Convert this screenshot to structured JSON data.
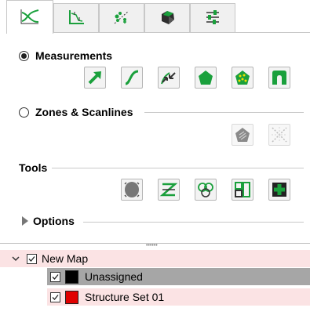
{
  "tabs": [
    {
      "icon": "curves-icon"
    },
    {
      "icon": "plot-axes-icon"
    },
    {
      "icon": "scatter-points-icon"
    },
    {
      "icon": "polyhedron-icon"
    },
    {
      "icon": "sliders-icon"
    }
  ],
  "measurements": {
    "label": "Measurements",
    "selected": true,
    "tools": [
      "arrow-measure-icon",
      "curve-measure-icon",
      "convergence-measure-icon",
      "polygon-measure-icon",
      "region-measure-icon",
      "tunnel-measure-icon"
    ]
  },
  "zones": {
    "label": "Zones & Scanlines",
    "selected": false,
    "tools": [
      "zone-polygon-icon",
      "scanline-icon"
    ]
  },
  "tools": {
    "label": "Tools",
    "tools": [
      "blob-tool-icon",
      "section-tool-icon",
      "cluster-tool-icon",
      "layout-tool-icon",
      "add-tool-icon"
    ]
  },
  "options": {
    "label": "Options"
  },
  "tree": {
    "root": {
      "label": "New Map",
      "checked": true
    },
    "items": [
      {
        "label": "Unassigned",
        "checked": true,
        "color": "#000000"
      },
      {
        "label": "Structure Set 01",
        "checked": true,
        "color": "#e00000"
      }
    ]
  },
  "colors": {
    "accent_green": "#1aa03c",
    "highlight_row": "#a6a6a6",
    "pink_row": "#fbe3e4"
  }
}
